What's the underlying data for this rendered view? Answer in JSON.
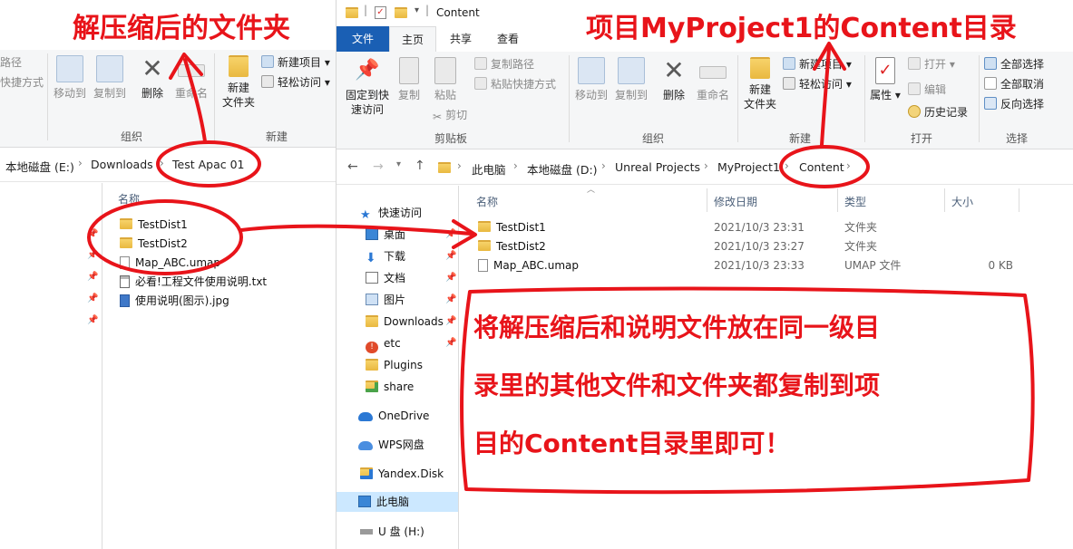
{
  "left": {
    "ribbon": {
      "partial_top": "路径",
      "partial_bottom": "快捷方式",
      "move_to": "移动到",
      "copy_to": "复制到",
      "delete": "删除",
      "rename": "重命名",
      "new_folder": "新建\n文件夹",
      "new_item": "新建项目",
      "easy_access": "轻松访问",
      "group_organize": "组织",
      "group_new": "新建"
    },
    "breadcrumb": [
      "本地磁盘 (E:)",
      "Downloads",
      "Test Apac 01"
    ],
    "column_name": "名称",
    "files": [
      {
        "name": "TestDist1",
        "type": "folder"
      },
      {
        "name": "TestDist2",
        "type": "folder"
      },
      {
        "name": "Map_ABC.umap",
        "type": "file"
      },
      {
        "name": "必看!工程文件使用说明.txt",
        "type": "txt"
      },
      {
        "name": "使用说明(图示).jpg",
        "type": "jpg"
      }
    ]
  },
  "right": {
    "title": "Content",
    "tabs": [
      "文件",
      "主页",
      "共享",
      "查看"
    ],
    "ribbon": {
      "pin": "固定到快\n速访问",
      "copy": "复制",
      "paste": "粘贴",
      "copy_path": "复制路径",
      "paste_shortcut": "粘贴快捷方式",
      "cut": "剪切",
      "group_clipboard": "剪贴板",
      "move_to": "移动到",
      "copy_to": "复制到",
      "delete": "删除",
      "rename": "重命名",
      "group_organize": "组织",
      "new_folder": "新建\n文件夹",
      "new_item": "新建项目",
      "easy_access": "轻松访问",
      "group_new": "新建",
      "properties": "属性",
      "open": "打开",
      "edit": "编辑",
      "history": "历史记录",
      "group_open": "打开",
      "select_all": "全部选择",
      "select_none": "全部取消",
      "invert": "反向选择",
      "group_select": "选择"
    },
    "breadcrumb": [
      "此电脑",
      "本地磁盘 (D:)",
      "Unreal Projects",
      "MyProject1",
      "Content"
    ],
    "columns": {
      "name": "名称",
      "date": "修改日期",
      "type": "类型",
      "size": "大小"
    },
    "files": [
      {
        "name": "TestDist1",
        "date": "2021/10/3 23:31",
        "type": "文件夹",
        "size": "",
        "icon": "folder"
      },
      {
        "name": "TestDist2",
        "date": "2021/10/3 23:27",
        "type": "文件夹",
        "size": "",
        "icon": "folder"
      },
      {
        "name": "Map_ABC.umap",
        "date": "2021/10/3 23:33",
        "type": "UMAP 文件",
        "size": "0 KB",
        "icon": "file"
      }
    ],
    "nav": [
      {
        "label": "快速访问",
        "icon": "star-icon"
      },
      {
        "label": "桌面",
        "icon": "desktop-icon"
      },
      {
        "label": "下载",
        "icon": "download-icon"
      },
      {
        "label": "文档",
        "icon": "document-icon"
      },
      {
        "label": "图片",
        "icon": "picture-icon"
      },
      {
        "label": "Downloads",
        "icon": "folder-icon"
      },
      {
        "label": "etc",
        "icon": "folder-warning-icon"
      },
      {
        "label": "Plugins",
        "icon": "folder-icon"
      },
      {
        "label": "share",
        "icon": "shared-folder-icon"
      },
      {
        "label": "OneDrive",
        "icon": "cloud-icon"
      },
      {
        "label": "WPS网盘",
        "icon": "wps-cloud-icon"
      },
      {
        "label": "Yandex.Disk",
        "icon": "yandex-disk-icon"
      },
      {
        "label": "此电脑",
        "icon": "computer-icon"
      },
      {
        "label": "U 盘 (H:)",
        "icon": "usb-drive-icon"
      }
    ]
  },
  "annotations": {
    "left_title": "解压缩后的文件夹",
    "right_title": "项目MyProject1的Content目录",
    "note_lines": [
      "将解压缩后和说明文件放在同一级目",
      "录里的其他文件和文件夹都复制到项",
      "目的Content目录里即可！"
    ]
  },
  "colors": {
    "annotation_red": "#e8141a",
    "tab_file_blue": "#1a5fb4",
    "selected_nav": "#cce8ff"
  }
}
